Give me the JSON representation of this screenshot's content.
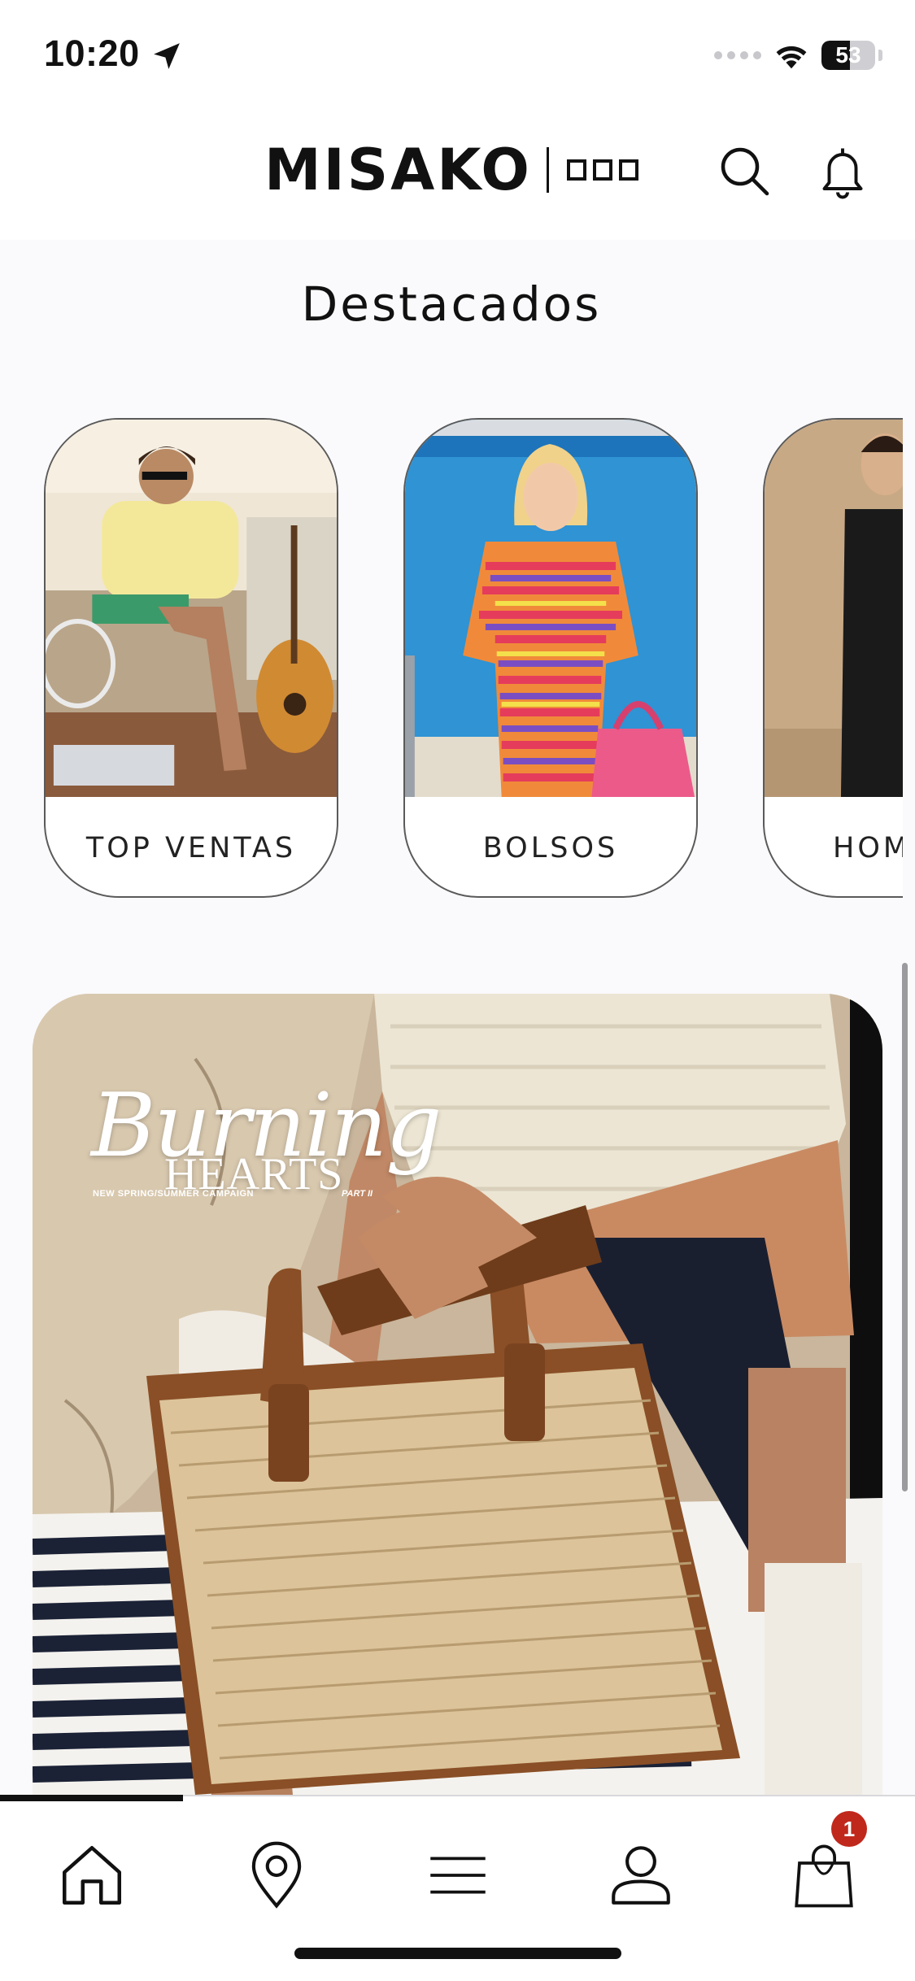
{
  "status_bar": {
    "time": "10:20",
    "battery_level": "53",
    "battery_fraction": 0.53
  },
  "header": {
    "brand": "MISAKO",
    "icons": [
      "search-icon",
      "bell-icon"
    ]
  },
  "featured": {
    "title": "Destacados",
    "categories": [
      {
        "label": "TOP VENTAS"
      },
      {
        "label": "BOLSOS"
      },
      {
        "label": "HOM"
      }
    ]
  },
  "banner": {
    "script_title": "Burning",
    "hearts_title": "HEARTS",
    "subtitle": "NEW SPRING/SUMMER CAMPAIGN",
    "part": "PART II"
  },
  "bottom_nav": {
    "items": [
      "home-icon",
      "location-icon",
      "menu-icon",
      "profile-icon",
      "bag-icon"
    ],
    "cart_count": "1",
    "progress_fraction": 0.2
  },
  "colors": {
    "accent_badge": "#c0281c",
    "text": "#111111",
    "background": "#faf9fb"
  }
}
